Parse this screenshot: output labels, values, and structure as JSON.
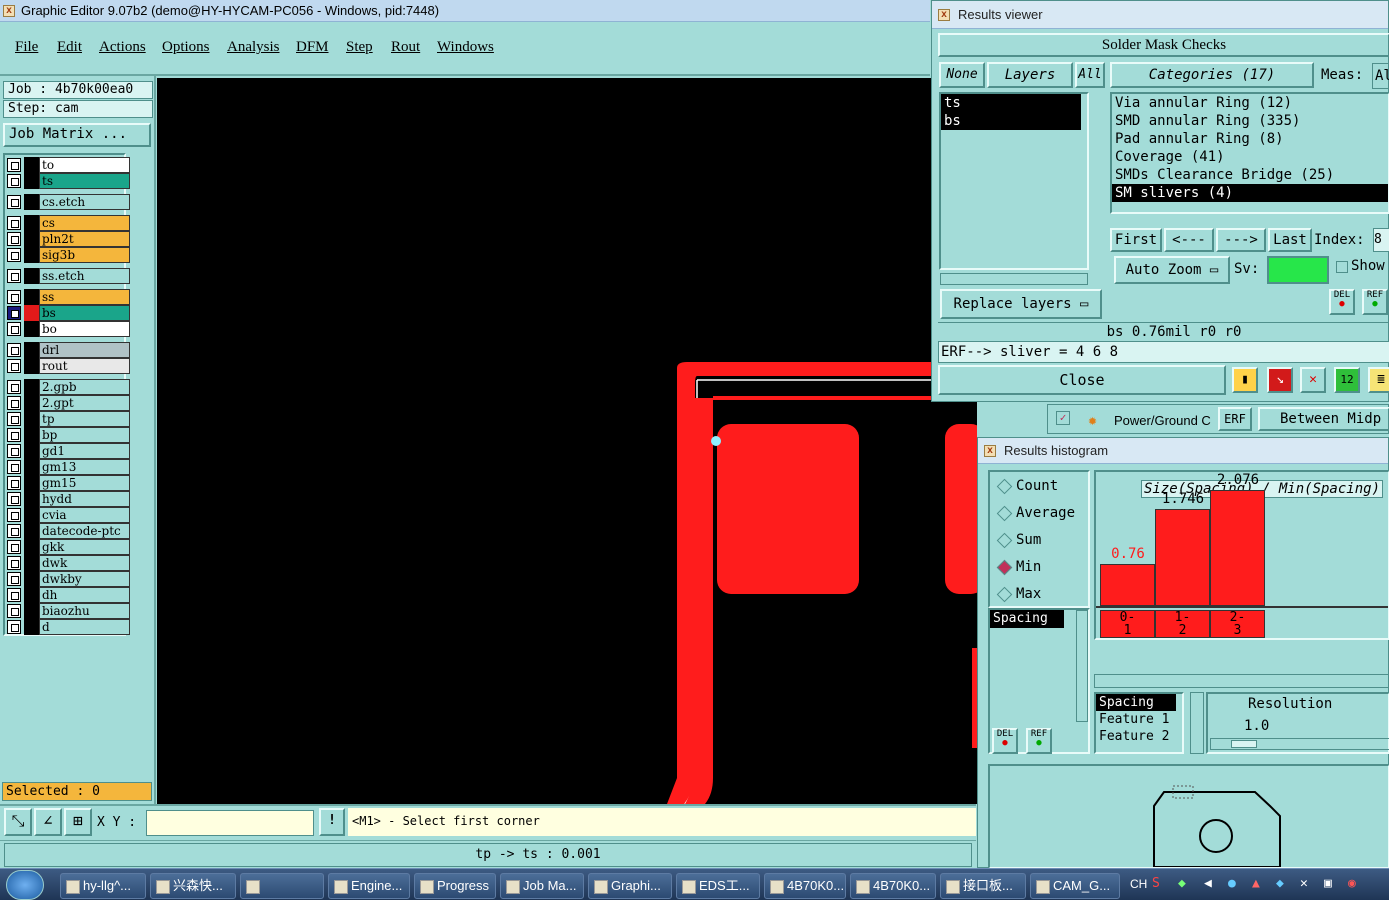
{
  "app": {
    "title": "Graphic Editor 9.07b2 (demo@HY-HYCAM-PC056 - Windows, pid:7448)"
  },
  "menu": [
    "File",
    "Edit",
    "Actions",
    "Options",
    "Analysis",
    "DFM",
    "Step",
    "Rout",
    "Windows"
  ],
  "left": {
    "job": "Job : 4b70k00ea0",
    "step": "Step: cam",
    "matrix_button": "Job Matrix ...",
    "selected": "Selected : 0",
    "layers": [
      {
        "name": "to",
        "color": "#ffffff"
      },
      {
        "name": "ts",
        "color": "#1aa58a"
      },
      {
        "name": "cs.etch",
        "color": "#a3dcd8"
      },
      {
        "name": "cs",
        "color": "#f4b63c"
      },
      {
        "name": "pln2t",
        "color": "#f4b63c"
      },
      {
        "name": "sig3b",
        "color": "#f4b63c"
      },
      {
        "name": "ss.etch",
        "color": "#a3dcd8"
      },
      {
        "name": "ss",
        "color": "#f4b63c"
      },
      {
        "name": "bs",
        "color": "#1aa58a"
      },
      {
        "name": "bo",
        "color": "#ffffff"
      },
      {
        "name": "drl",
        "color": "#b0c2c6"
      },
      {
        "name": "rout",
        "color": "#e8e8e8"
      },
      {
        "name": "2.gpb",
        "color": "#a3dcd8"
      },
      {
        "name": "2.gpt",
        "color": "#a3dcd8"
      },
      {
        "name": "tp",
        "color": "#a3dcd8"
      },
      {
        "name": "bp",
        "color": "#a3dcd8"
      },
      {
        "name": "gd1",
        "color": "#a3dcd8"
      },
      {
        "name": "gm13",
        "color": "#a3dcd8"
      },
      {
        "name": "gm15",
        "color": "#a3dcd8"
      },
      {
        "name": "hydd",
        "color": "#a3dcd8"
      },
      {
        "name": "cvia",
        "color": "#a3dcd8"
      },
      {
        "name": "datecode-ptc",
        "color": "#a3dcd8"
      },
      {
        "name": "gkk",
        "color": "#a3dcd8"
      },
      {
        "name": "dwk",
        "color": "#a3dcd8"
      },
      {
        "name": "dwkby",
        "color": "#a3dcd8"
      },
      {
        "name": "dh",
        "color": "#a3dcd8"
      },
      {
        "name": "biaozhu",
        "color": "#a3dcd8"
      },
      {
        "name": "d",
        "color": "#a3dcd8"
      }
    ]
  },
  "cmd": {
    "xy_label": "X Y :",
    "xy_value": "",
    "prompt": "<M1> - Select first corner"
  },
  "status": {
    "text": "tp -> ts : 0.001"
  },
  "viewer": {
    "title": "Results viewer",
    "header": "Solder Mask Checks",
    "none": "None",
    "layers_tab": "Layers",
    "all": "All",
    "categories_tab": "Categories (17)",
    "meas": "Meas:",
    "meas_val": "Al",
    "layer_list": [
      "ts",
      "bs"
    ],
    "categories": [
      "Via annular Ring (12)",
      "SMD annular Ring (335)",
      "Pad annular Ring (8)",
      "Coverage (41)",
      "SMDs Clearance Bridge (25)",
      "SM slivers (4)"
    ],
    "first": "First",
    "prev": "<---",
    "next": "--->",
    "last": "Last",
    "index": "Index:",
    "index_val": "8",
    "auto_zoom": "Auto Zoom",
    "sv": "Sv:",
    "show": "Show",
    "replace": "Replace layers",
    "del": "DEL",
    "ref": "REF",
    "info": "bs 0.76mil  r0  r0",
    "erf": "ERF--> sliver = 4 6 8",
    "close": "Close"
  },
  "under": {
    "power": "Power/Ground C",
    "erf": "ERF",
    "between": "Between Midp"
  },
  "histogram": {
    "title": "Results histogram",
    "modes": [
      "Count",
      "Average",
      "Sum",
      "Min",
      "Max"
    ],
    "selected_mode": "Min",
    "list_item": "Spacing",
    "chart_title": "Size(Spacing) / Min(Spacing)",
    "list2": [
      "Spacing",
      "Feature 1",
      "Feature 2"
    ],
    "resolution": "Resolution",
    "res_val": "1.0",
    "del": "DEL",
    "ref": "REF"
  },
  "chart_data": {
    "type": "bar",
    "title": "Size(Spacing) / Min(Spacing)",
    "categories": [
      "0-1",
      "1-2",
      "2-3"
    ],
    "values": [
      0.76,
      1.746,
      2.076
    ],
    "labels": [
      "0.76",
      "1.746",
      "2.076"
    ],
    "ylim": [
      0,
      2.4
    ],
    "color": "#ff1c1c"
  },
  "taskbar": {
    "items": [
      "hy-llg^...",
      "兴森快...",
      "",
      "Engine...",
      "Progress",
      "Job Ma...",
      "Graphi...",
      "EDS工...",
      "4B70K0...",
      "4B70K0...",
      "接口板...",
      "CAM_G..."
    ],
    "tray": "CH"
  }
}
